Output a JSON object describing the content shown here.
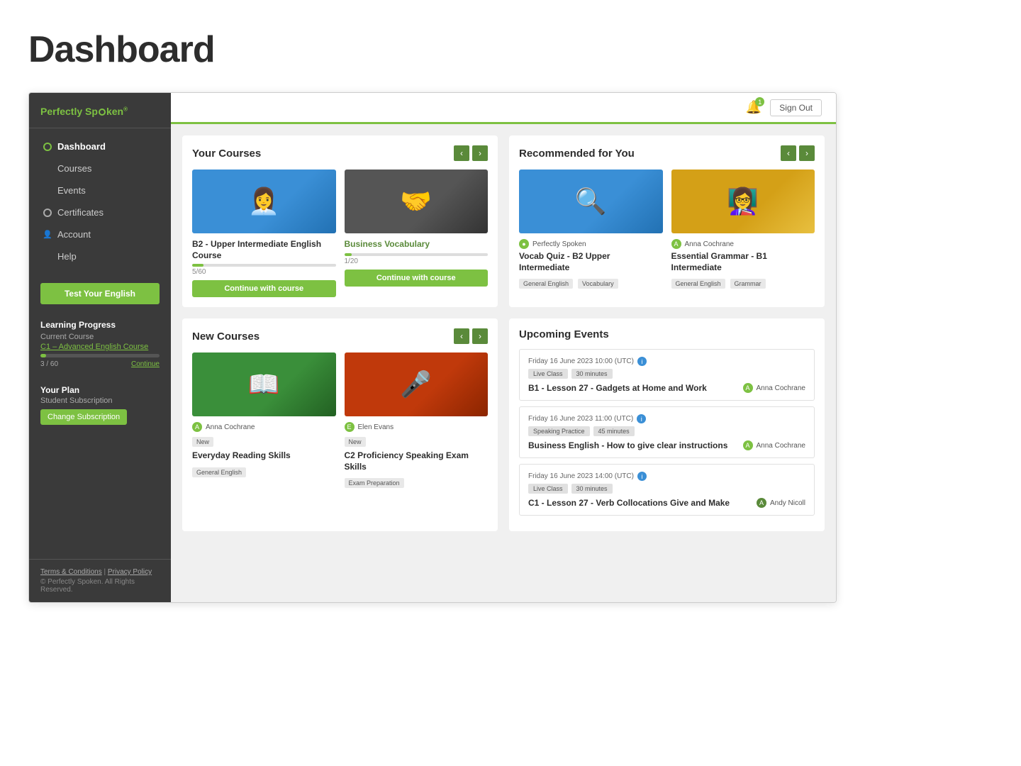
{
  "pageTitle": "Dashboard",
  "sidebar": {
    "logo": "Perfectly Spoken",
    "nav": [
      {
        "label": "Dashboard",
        "active": true,
        "icon": "circle"
      },
      {
        "label": "Courses",
        "active": false,
        "icon": "none"
      },
      {
        "label": "Events",
        "active": false,
        "icon": "none"
      },
      {
        "label": "Certificates",
        "active": false,
        "icon": "circle-outline"
      },
      {
        "label": "Account",
        "active": false,
        "icon": "person"
      },
      {
        "label": "Help",
        "active": false,
        "icon": "none"
      }
    ],
    "testBtn": "Test Your English",
    "learningProgress": {
      "title": "Learning Progress",
      "currentLabel": "Current Course",
      "courseName": "C1 – Advanced English Course",
      "progress": 5,
      "progressMax": 60,
      "progressText": "3 / 60",
      "continueLabel": "Continue"
    },
    "plan": {
      "title": "Your Plan",
      "subscription": "Student Subscription",
      "changeBtn": "Change Subscription"
    },
    "footer": {
      "terms": "Terms & Conditions",
      "privacy": "Privacy Policy",
      "copyright": "© Perfectly Spoken. All Rights Reserved."
    }
  },
  "header": {
    "notifCount": "1",
    "signOut": "Sign Out"
  },
  "yourCourses": {
    "title": "Your Courses",
    "cards": [
      {
        "thumb": "thumb-blue-woman",
        "name": "B2 - Upper Intermediate English Course",
        "progress": 8,
        "progressText": "5/60",
        "btnLabel": "Continue with course"
      },
      {
        "thumb": "thumb-business-meeting",
        "name": "Business Vocabulary",
        "progress": 5,
        "progressText": "1/20",
        "btnLabel": "Continue with course"
      }
    ]
  },
  "recommendedForYou": {
    "title": "Recommended for You",
    "cards": [
      {
        "thumb": "thumb-vocab-quiz",
        "instructor": "Perfectly Spoken",
        "title": "Vocab Quiz - B2 Upper Intermediate",
        "tags": [
          "General English",
          "Vocabulary"
        ]
      },
      {
        "thumb": "thumb-grammar",
        "instructor": "Anna Cochrane",
        "title": "Essential Grammar - B1 Intermediate",
        "tags": [
          "General English",
          "Grammar"
        ]
      }
    ]
  },
  "newCourses": {
    "title": "New Courses",
    "cards": [
      {
        "thumb": "thumb-reading",
        "instructor": "Anna Cochrane",
        "badge": "New",
        "name": "Everyday Reading Skills",
        "tags": [
          "General English"
        ]
      },
      {
        "thumb": "thumb-speaking",
        "instructor": "Elen Evans",
        "badge": "New",
        "name": "C2 Proficiency Speaking Exam Skills",
        "tags": [
          "Exam Preparation"
        ]
      }
    ]
  },
  "upcomingEvents": {
    "title": "Upcoming Events",
    "events": [
      {
        "date": "Friday 16 June 2023 10:00 (UTC)",
        "tags": [
          "Live Class",
          "30 minutes"
        ],
        "title": "B1 - Lesson 27 - Gadgets at Home and Work",
        "instructor": "Anna Cochrane"
      },
      {
        "date": "Friday 16 June 2023 11:00 (UTC)",
        "tags": [
          "Speaking Practice",
          "45 minutes"
        ],
        "title": "Business English - How to give clear instructions",
        "instructor": "Anna Cochrane"
      },
      {
        "date": "Friday 16 June 2023 14:00 (UTC)",
        "tags": [
          "Live Class",
          "30 minutes"
        ],
        "title": "C1 - Lesson 27 - Verb Collocations Give and Make",
        "instructor": "Andy Nicoll"
      }
    ]
  }
}
